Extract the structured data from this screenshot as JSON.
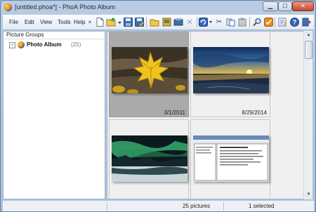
{
  "window": {
    "title": "[untitled.phoa*] - PhoA Photo Album"
  },
  "menu": {
    "items": [
      "File",
      "Edit",
      "View",
      "Tools",
      "Help"
    ]
  },
  "toolbar": {
    "icons": [
      "close-doc-icon",
      "new-icon",
      "open-icon",
      "save-icon",
      "save-as-icon",
      "new-group-icon",
      "add-pictures-icon",
      "copy-icon",
      "delete-icon",
      "undo-icon",
      "cut-icon",
      "paste-icon",
      "clipboard-icon",
      "find-icon",
      "check-icon",
      "properties-icon",
      "help-icon",
      "exit-icon"
    ]
  },
  "left_panel": {
    "header": "Picture Groups",
    "tree": [
      {
        "label": "Photo Album",
        "count": "(25)",
        "toggle": "-"
      }
    ]
  },
  "gallery": {
    "thumbnails": [
      {
        "date": "3/1/2011",
        "selected": true,
        "subject": "maple-leaf"
      },
      {
        "date": "8/29/2014",
        "selected": false,
        "subject": "sunset-beach"
      },
      {
        "date": "",
        "selected": false,
        "subject": "aurora-landscape"
      },
      {
        "date": "",
        "selected": false,
        "subject": "screenshot"
      }
    ]
  },
  "statusbar": {
    "count": "25 pictures",
    "selected": "1 selected"
  },
  "colors": {
    "selection": "#aaaaaa",
    "title_bar": "#b8cde3",
    "close_button": "#c4442a"
  }
}
